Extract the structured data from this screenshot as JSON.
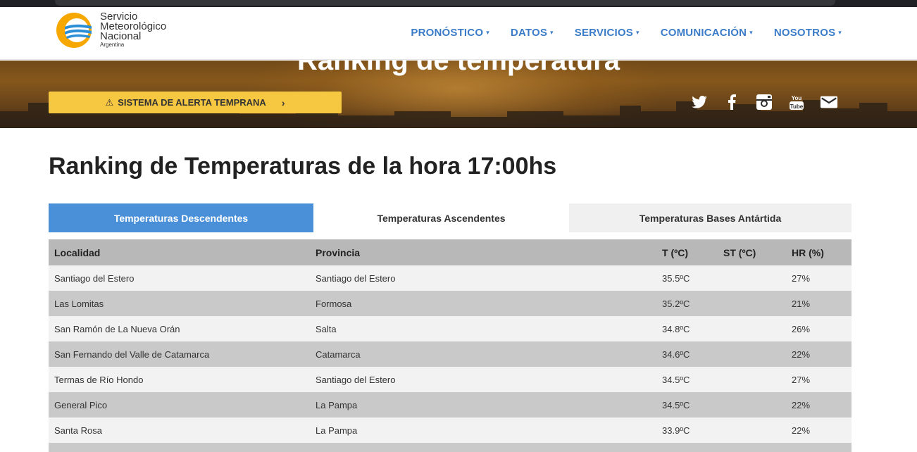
{
  "logo": {
    "line1": "Servicio",
    "line2": "Meteorológico",
    "line3": "Nacional",
    "line4": "Argentina",
    "colors": {
      "orange": "#f6a800",
      "blue": "#2a8fd6"
    }
  },
  "nav": {
    "items": [
      {
        "label": "PRONÓSTICO"
      },
      {
        "label": "DATOS"
      },
      {
        "label": "SERVICIOS"
      },
      {
        "label": "COMUNICACIÓN"
      },
      {
        "label": "NOSOTROS"
      }
    ],
    "caret": "▾",
    "color": "#3a7cc8"
  },
  "banner": {
    "title": "Ranking de temperatura",
    "alert_button": {
      "label": "SISTEMA DE ALERTA TEMPRANA",
      "icon": "warning-icon",
      "chevron": "›"
    },
    "social_icons": [
      "twitter-icon",
      "facebook-icon",
      "instagram-icon",
      "youtube-icon",
      "mail-icon"
    ]
  },
  "page": {
    "title": "Ranking de Temperaturas de la hora 17:00hs"
  },
  "tabs": [
    {
      "label": "Temperaturas Descendentes",
      "active": true
    },
    {
      "label": "Temperaturas Ascendentes",
      "active": false
    },
    {
      "label": "Temperaturas Bases Antártida",
      "active": false
    }
  ],
  "table": {
    "headers": {
      "localidad": "Localidad",
      "provincia": "Provincia",
      "t": "T (ºC)",
      "st": "ST (ºC)",
      "hr": "HR (%)"
    },
    "rows": [
      {
        "localidad": "Santiago del Estero",
        "provincia": "Santiago del Estero",
        "t": "35.5ºC",
        "st": "",
        "hr": "27%"
      },
      {
        "localidad": "Las Lomitas",
        "provincia": "Formosa",
        "t": "35.2ºC",
        "st": "",
        "hr": "21%"
      },
      {
        "localidad": "San Ramón de La Nueva Orán",
        "provincia": "Salta",
        "t": "34.8ºC",
        "st": "",
        "hr": "26%"
      },
      {
        "localidad": "San Fernando del Valle de Catamarca",
        "provincia": "Catamarca",
        "t": "34.6ºC",
        "st": "",
        "hr": "22%"
      },
      {
        "localidad": "Termas de Río Hondo",
        "provincia": "Santiago del Estero",
        "t": "34.5ºC",
        "st": "",
        "hr": "27%"
      },
      {
        "localidad": "General Pico",
        "provincia": "La Pampa",
        "t": "34.5ºC",
        "st": "",
        "hr": "22%"
      },
      {
        "localidad": "Santa Rosa",
        "provincia": "La Pampa",
        "t": "33.9ºC",
        "st": "",
        "hr": "22%"
      },
      {
        "localidad": "",
        "provincia": "",
        "t": "",
        "st": "",
        "hr": ""
      }
    ],
    "colors": {
      "header": "#b8b8b8",
      "row_light": "#f2f2f2",
      "row_dark": "#c9c9c9",
      "active_tab": "#4a90d9",
      "alert": "#f6c740"
    }
  }
}
